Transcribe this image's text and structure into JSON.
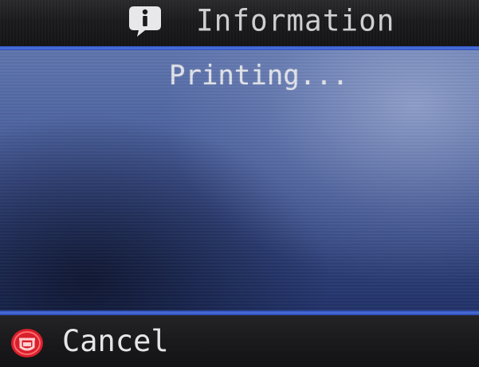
{
  "header": {
    "title": "Information",
    "icon": "info-icon"
  },
  "main": {
    "status": "Printing..."
  },
  "footer": {
    "cancel_label": "Cancel",
    "cancel_icon": "stop-icon"
  },
  "colors": {
    "accent_blue": "#4e74e4",
    "panel_blue": "#4e64a0",
    "stop_red": "#e0202c",
    "text": "#e2e4ea"
  }
}
